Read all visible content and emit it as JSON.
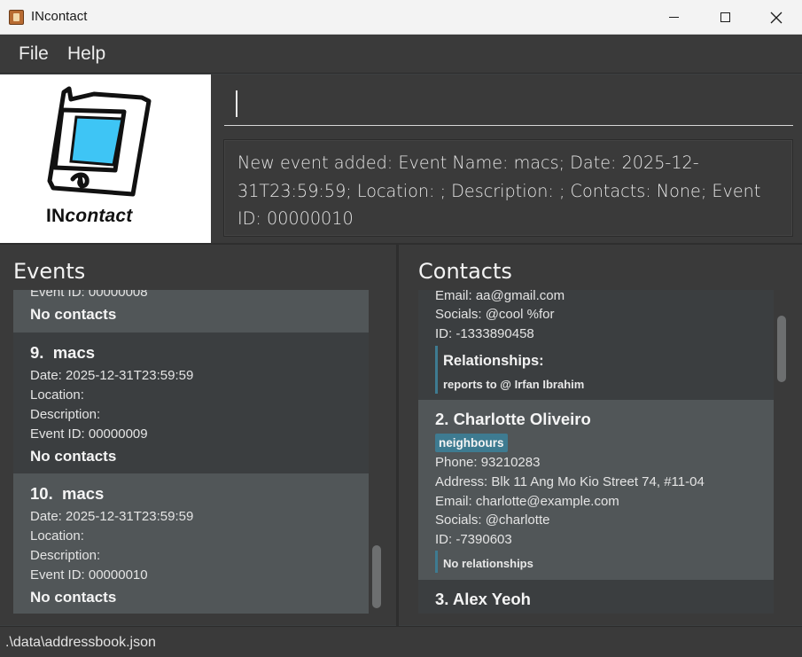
{
  "window": {
    "title": "INcontact",
    "minimize_icon": "minimize-icon",
    "maximize_icon": "maximize-icon",
    "close_icon": "close-icon"
  },
  "menu": {
    "file": "File",
    "help": "Help"
  },
  "logo": {
    "text_bold": "IN",
    "text_italic": "contact",
    "icon": "tablet-logo-icon"
  },
  "command": {
    "value": ""
  },
  "result": {
    "text": "New event added: Event Name: macs; Date: 2025-12-31T23:59:59; Location: ; Description: ; Contacts: None; Event ID: 00000010"
  },
  "events": {
    "heading": "Events",
    "items": [
      {
        "id_line": "Event ID: 00000008",
        "contacts": "No contacts"
      },
      {
        "index": "9.",
        "name": "macs",
        "date": "Date: 2025-12-31T23:59:59",
        "location": "Location:",
        "description": "Description:",
        "id_line": "Event ID: 00000009",
        "contacts": "No contacts"
      },
      {
        "index": "10.",
        "name": "macs",
        "date": "Date: 2025-12-31T23:59:59",
        "location": "Location:",
        "description": "Description:",
        "id_line": "Event ID: 00000010",
        "contacts": "No contacts"
      }
    ]
  },
  "contacts": {
    "heading": "Contacts",
    "items": [
      {
        "email": "Email: aa@gmail.com",
        "socials": "Socials: @cool %for",
        "id_line": "ID: -1333890458",
        "relationships_title": "Relationships:",
        "relationship": "reports to @  Irfan Ibrahim"
      },
      {
        "title": "2. Charlotte Oliveiro",
        "tag": "neighbours",
        "phone": "Phone: 93210283",
        "address": "Address: Blk 11 Ang Mo Kio Street 74, #11-04",
        "email": "Email: charlotte@example.com",
        "socials": "Socials: @charlotte",
        "id_line": "ID: -7390603",
        "relationships": "No relationships"
      },
      {
        "title": "3. Alex Yeoh"
      }
    ]
  },
  "status": {
    "path": ".\\data\\addressbook.json"
  },
  "colors": {
    "background": "#3a3a3a",
    "card_light": "#515658",
    "card_dark": "#3b3e40",
    "tag": "#3e7b91",
    "logo_screen": "#3ec5f5"
  }
}
